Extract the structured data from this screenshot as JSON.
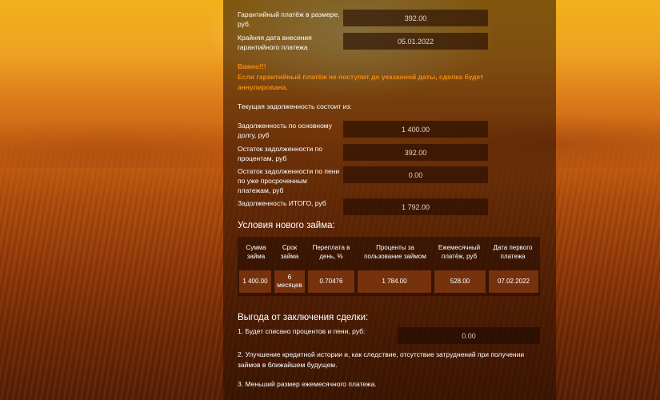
{
  "guarantee": {
    "payment_label": "Гарантийный платёж в размере, руб.",
    "payment_value": "392.00",
    "deadline_label": "Крайняя дата внесения гарантийного платежа",
    "deadline_value": "05.01.2022"
  },
  "warning": {
    "title": "Важно!!!",
    "text": "Если гарантийный платёж не поступит до указанной даты, сделка будет аннулирована."
  },
  "debt": {
    "heading": "Текущая задолженность состоит из:",
    "items": [
      {
        "label": "Задолженность по основному долгу, руб",
        "value": "1 400.00"
      },
      {
        "label": "Остаток задолженности по процентам, руб",
        "value": "392.00"
      },
      {
        "label": "Остаток задолженности по пени по уже просроченным платежам, руб",
        "value": "0.00"
      },
      {
        "label": "Задолженность ИТОГО, руб",
        "value": "1 792.00"
      }
    ]
  },
  "new_loan": {
    "heading": "Условия нового займа:",
    "headers": [
      "Сумма займа",
      "Срок займа",
      "Переплата в день, %",
      "Проценты за пользование займом",
      "Ежемесячный платёж, руб",
      "Дата первого платежа"
    ],
    "row": [
      "1 400.00",
      "6 месяцев",
      "0.70476",
      "1 784.00",
      "528.00",
      "07.02.2022"
    ]
  },
  "benefits": {
    "heading": "Выгода от заключения сделки:",
    "item1": "1. Будет списано процентов и пени, руб:",
    "item1_value": "0.00",
    "item2": "2. Улучшение кредитной истории и, как следствие, отсутствие затруднений при получении займов в ближайшем будущем.",
    "item3": "3. Меньший размер ежемесячного платежа."
  }
}
